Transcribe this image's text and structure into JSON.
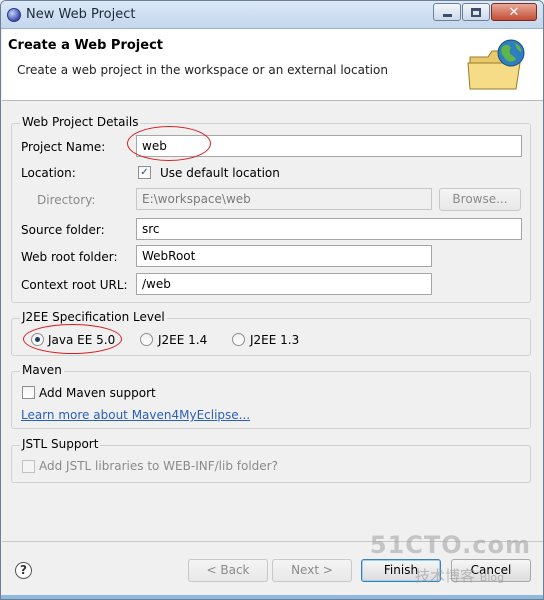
{
  "window": {
    "title": "New Web Project"
  },
  "banner": {
    "title": "Create a Web Project",
    "description": "Create a web project in the workspace or an external location"
  },
  "details": {
    "group_title": "Web Project Details",
    "project_name_label": "Project Name:",
    "project_name_value": "web",
    "location_label": "Location:",
    "use_default_label": "Use default location",
    "use_default_checked": true,
    "directory_label": "Directory:",
    "directory_value": "E:\\workspace\\web",
    "browse_label": "Browse...",
    "source_folder_label": "Source folder:",
    "source_folder_value": "src",
    "web_root_label": "Web root folder:",
    "web_root_value": "WebRoot",
    "context_root_label": "Context root URL:",
    "context_root_value": "/web"
  },
  "j2ee": {
    "group_title": "J2EE Specification Level",
    "options": [
      {
        "label": "Java EE 5.0",
        "checked": true
      },
      {
        "label": "J2EE 1.4",
        "checked": false
      },
      {
        "label": "J2EE 1.3",
        "checked": false
      }
    ]
  },
  "maven": {
    "group_title": "Maven",
    "add_support_label": "Add Maven support",
    "learn_more_link": "Learn more about Maven4MyEclipse..."
  },
  "jstl": {
    "group_title": "JSTL Support",
    "add_libraries_label": "Add JSTL libraries to WEB-INF/lib folder?"
  },
  "footer": {
    "help_glyph": "?",
    "back_label": "< Back",
    "next_label": "Next >",
    "finish_label": "Finish",
    "cancel_label": "Cancel"
  },
  "watermark": {
    "top": "51CTO.com",
    "bottom": "技术博客",
    "blog": "Blog"
  },
  "colors": {
    "annotation_red": "#d81e1e",
    "link_blue": "#2a5fba"
  },
  "icons": {
    "app": "eclipse-icon",
    "banner": "globe-folder-icon",
    "help": "help-icon"
  }
}
